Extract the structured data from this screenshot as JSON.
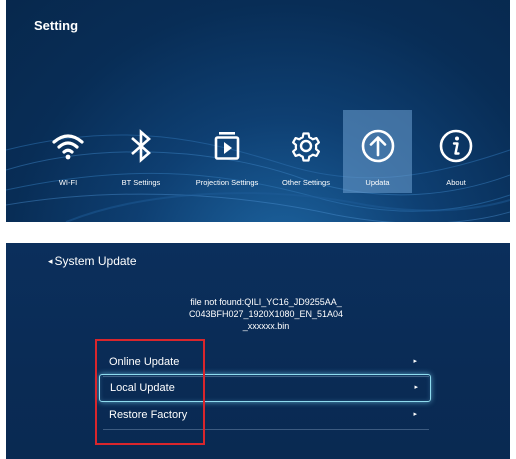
{
  "settings_screen": {
    "title": "Setting",
    "items": [
      {
        "label": "WI-FI",
        "icon": "wifi-icon"
      },
      {
        "label": "BT Settings",
        "icon": "bluetooth-icon"
      },
      {
        "label": "Projection Settings",
        "icon": "projection-icon"
      },
      {
        "label": "Other Settings",
        "icon": "gear-icon"
      },
      {
        "label": "Updata",
        "icon": "upload-arrow-icon",
        "selected": true
      },
      {
        "label": "About",
        "icon": "info-icon"
      }
    ],
    "colors": {
      "background": "#082d56",
      "selected": "#6ea0d2"
    }
  },
  "update_screen": {
    "title": "System Update",
    "message_lines": [
      "file not found:QILI_YC16_JD9255AA_",
      "C043BFH027_1920X1080_EN_51A04",
      "_xxxxxx.bin"
    ],
    "options": [
      {
        "label": "Online Update"
      },
      {
        "label": "Local Update",
        "active": true
      },
      {
        "label": "Restore Factory"
      }
    ],
    "colors": {
      "background": "#0a2b55",
      "focus_border": "#8fdcef",
      "annotation_box": "#d9262c"
    }
  }
}
